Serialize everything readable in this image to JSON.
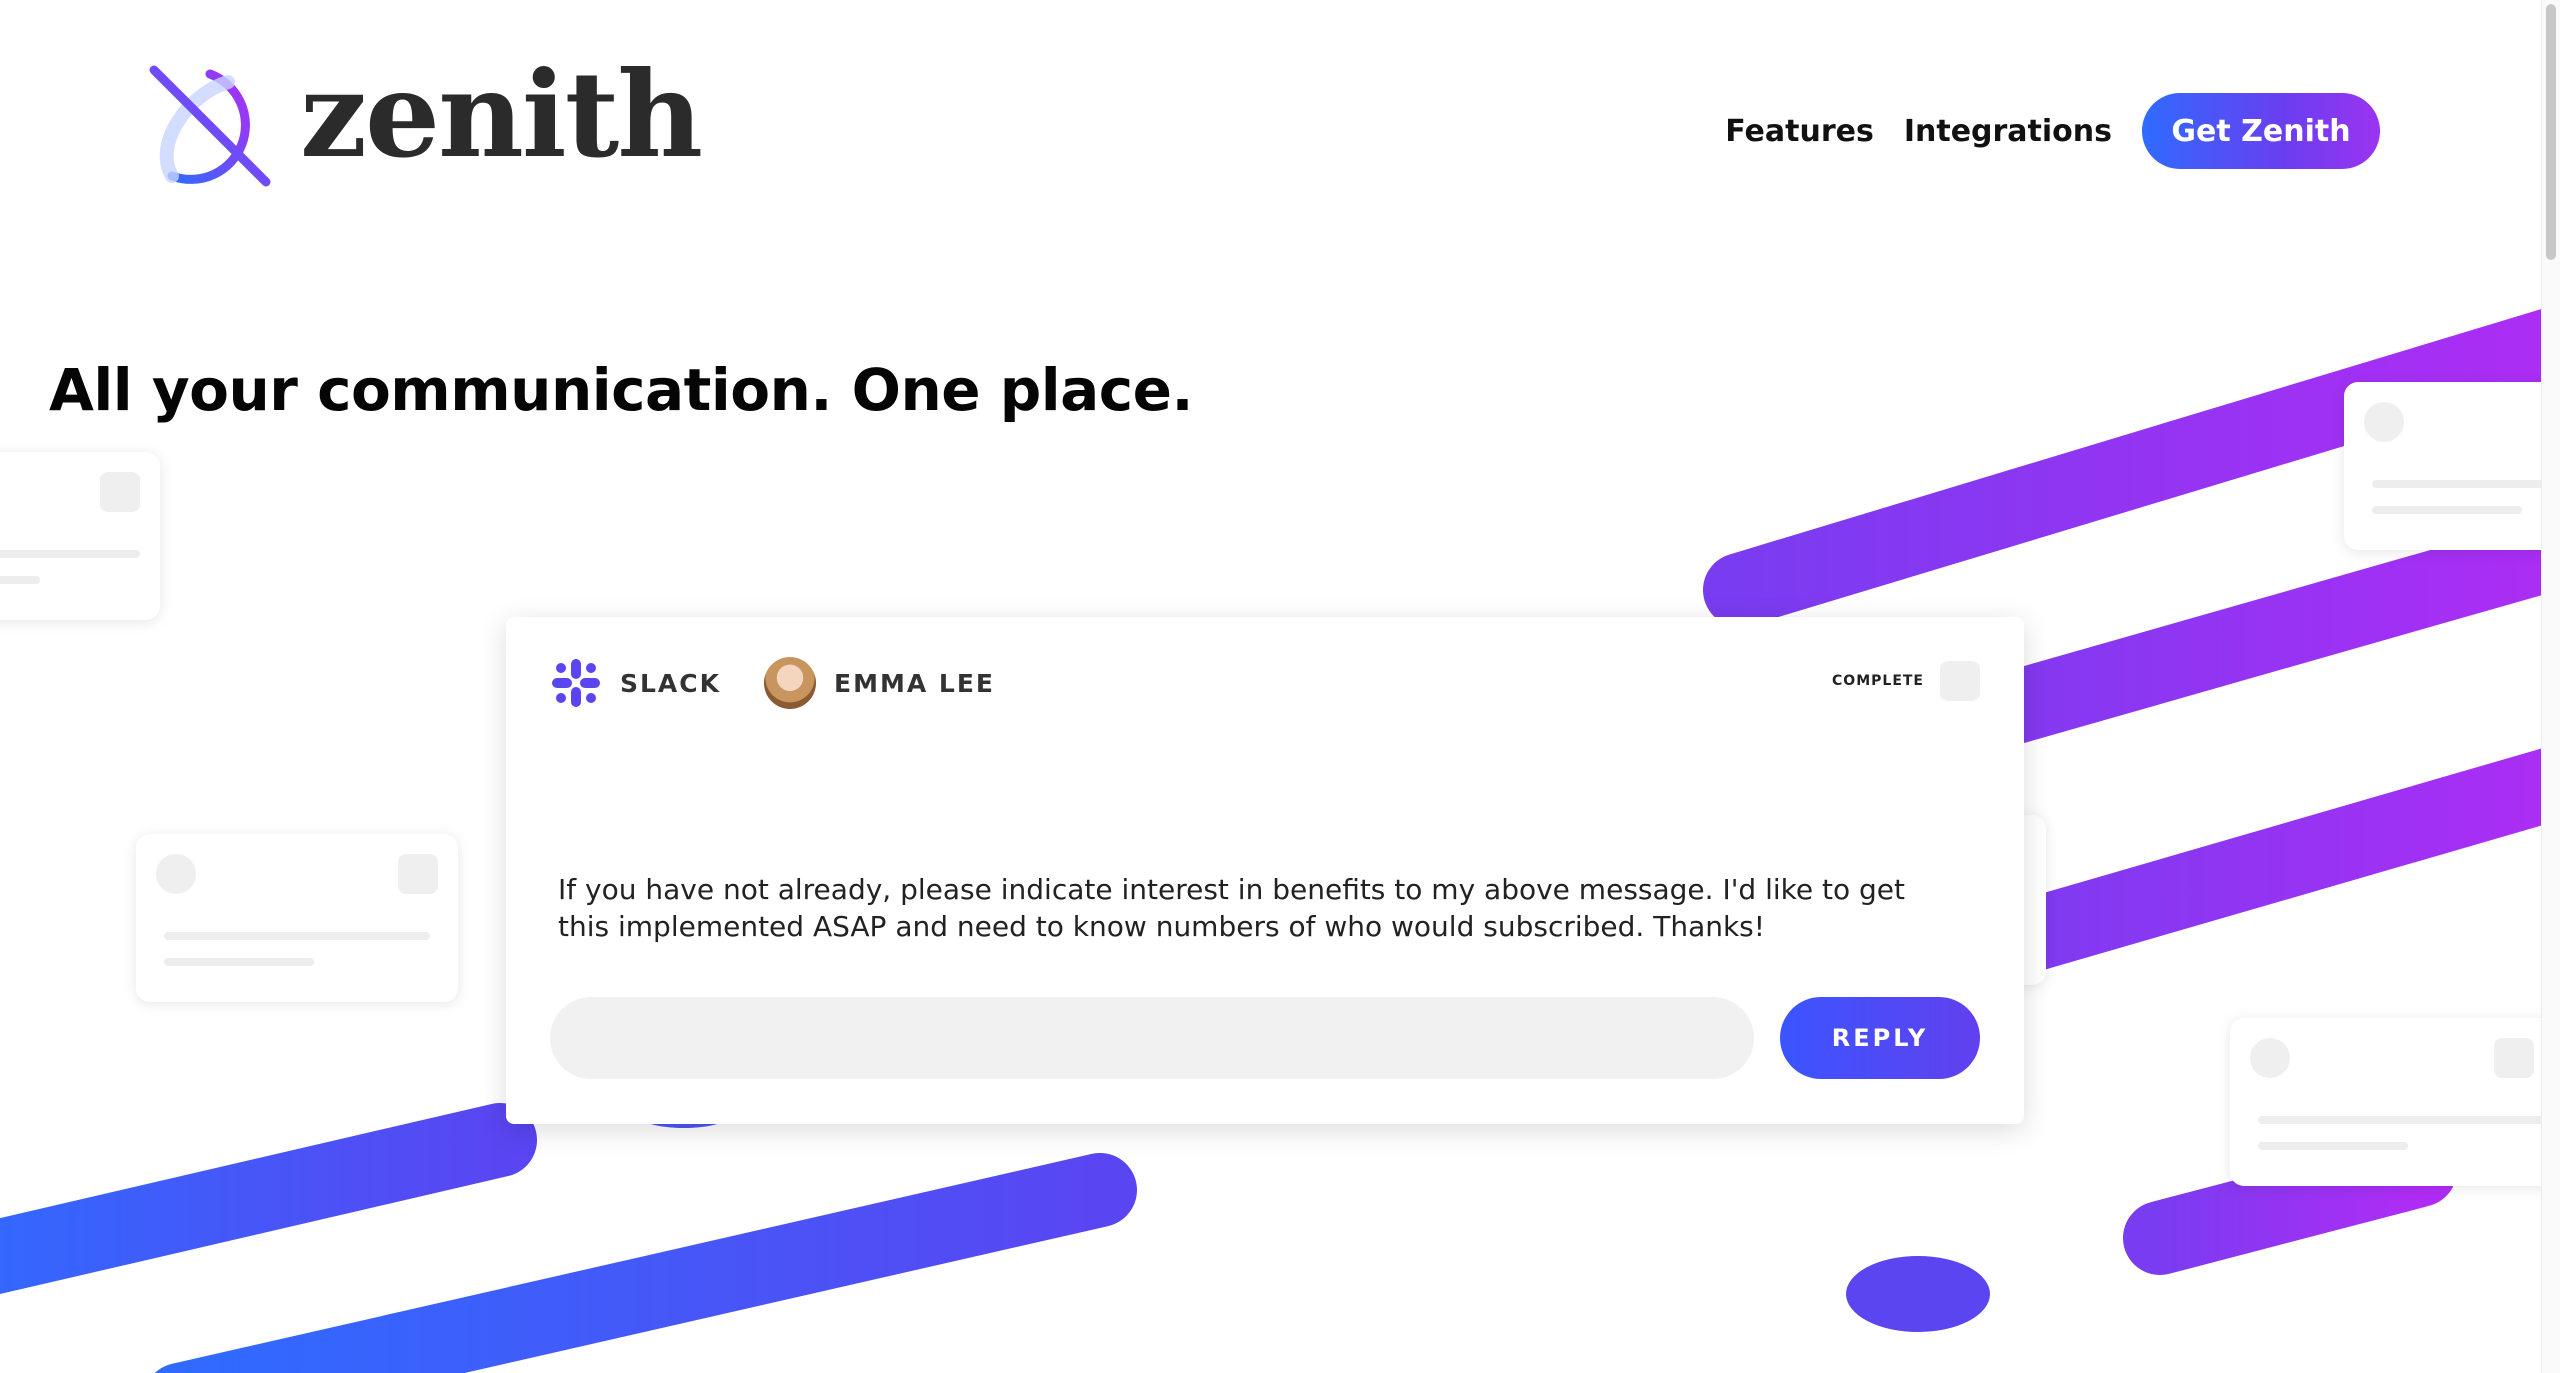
{
  "brand": {
    "name": "zenith"
  },
  "nav": {
    "features": "Features",
    "integrations": "Integrations",
    "cta": "Get Zenith"
  },
  "hero": {
    "headline": "All your communication. One place."
  },
  "message_card": {
    "source": "SLACK",
    "sender": "EMMA LEE",
    "status_label": "COMPLETE",
    "body": "If you have not already, please indicate interest in benefits to my above message. I'd like to get this implemented ASAP and need to know numbers of who would subscribed. Thanks!",
    "reply_placeholder": "",
    "reply_label": "REPLY"
  },
  "colors": {
    "blue": "#2f6bff",
    "purple": "#9b34f0",
    "indigo": "#5b45f0"
  },
  "icons": {
    "logo": "zenith-logo-icon",
    "source": "slack-icon"
  }
}
